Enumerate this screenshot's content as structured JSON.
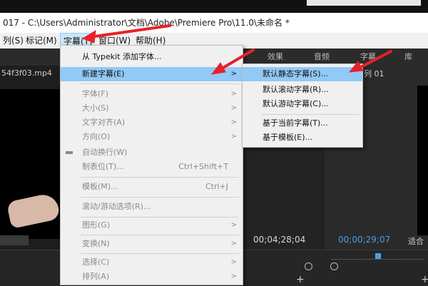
{
  "window": {
    "title": "017 - C:\\Users\\Administrator\\文档\\Adobe\\Premiere Pro\\11.0\\未命名 *"
  },
  "menubar": {
    "items": [
      {
        "label": "列(S)"
      },
      {
        "label": "标记(M)"
      },
      {
        "label": "字幕(T)"
      },
      {
        "label": "窗口(W)"
      },
      {
        "label": "帮助(H)"
      }
    ]
  },
  "panel_tabs": [
    "效果",
    "音频",
    "字幕",
    "库"
  ],
  "source": {
    "clip_name": "54f3f03.mp4",
    "timecode": "00;04;28;04"
  },
  "program": {
    "sequence_label": "列 01",
    "timecode": "00;00;29;07",
    "fit_label": "适合"
  },
  "title_menu": {
    "items": [
      {
        "label": "从 Typekit 添加字体...",
        "enabled": true
      },
      {
        "label": "新建字幕(E)",
        "enabled": true,
        "submenu": true
      },
      {
        "label": "字体(F)",
        "enabled": false,
        "submenu": true
      },
      {
        "label": "大小(S)",
        "enabled": false,
        "submenu": true
      },
      {
        "label": "文字对齐(A)",
        "enabled": false,
        "submenu": true
      },
      {
        "label": "方向(O)",
        "enabled": false,
        "submenu": true
      },
      {
        "label": "自动换行(W)",
        "enabled": false
      },
      {
        "label": "制表位(T)...",
        "enabled": false,
        "shortcut": "Ctrl+Shift+T"
      },
      {
        "label": "模板(M)...",
        "enabled": false,
        "shortcut": "Ctrl+J"
      },
      {
        "label": "滚动/游动选项(R)...",
        "enabled": false
      },
      {
        "label": "图形(G)",
        "enabled": false,
        "submenu": true
      },
      {
        "label": "变换(N)",
        "enabled": false,
        "submenu": true
      },
      {
        "label": "选择(C)",
        "enabled": false,
        "submenu": true
      },
      {
        "label": "排列(A)",
        "enabled": false,
        "submenu": true
      }
    ]
  },
  "new_title_submenu": {
    "items": [
      {
        "label": "默认静态字幕(S)..."
      },
      {
        "label": "默认滚动字幕(R)..."
      },
      {
        "label": "默认游动字幕(C)..."
      },
      {
        "label": "基于当前字幕(T)..."
      },
      {
        "label": "基于模板(E)..."
      }
    ]
  },
  "colors": {
    "highlight": "#91c9f7",
    "annotation_arrow": "#e8202a",
    "timecode_blue": "#4a9fe8"
  }
}
